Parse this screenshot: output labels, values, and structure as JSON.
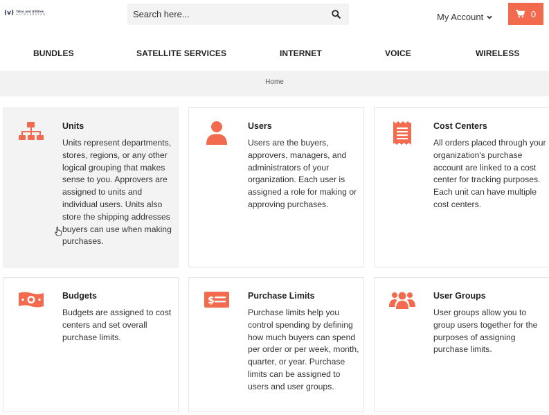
{
  "header": {
    "logo_name": "Telco and Utilities",
    "logo_subtitle": "ACCELERATOR",
    "search_placeholder": "Search here...",
    "account_label": "My Account",
    "cart_count": "0"
  },
  "nav": {
    "items": [
      {
        "label": "BUNDLES"
      },
      {
        "label": "SATELLITE SERVICES"
      },
      {
        "label": "INTERNET"
      },
      {
        "label": "VOICE"
      },
      {
        "label": "WIRELESS"
      }
    ]
  },
  "breadcrumb": {
    "home": "Home"
  },
  "cards": [
    {
      "icon": "org-chart-icon",
      "title": "Units",
      "description": "Units represent departments, stores, regions, or any other logical grouping that makes sense to you. Approvers are assigned to units and individual users. Units also store the shipping addresses buyers can use when making purchases."
    },
    {
      "icon": "user-icon",
      "title": "Users",
      "description": "Users are the buyers, approvers, managers, and administrators of your organization. Each user is assigned a role for making or approving purchases."
    },
    {
      "icon": "receipt-icon",
      "title": "Cost Centers",
      "description": "All orders placed through your organization's purchase account are linked to a cost center for tracking purposes. Each unit can have multiple cost centers."
    },
    {
      "icon": "money-bill-icon",
      "title": "Budgets",
      "description": "Budgets are assigned to cost centers and set overall purchase limits."
    },
    {
      "icon": "money-check-icon",
      "title": "Purchase Limits",
      "description": "Purchase limits help you control spending by defining how much buyers can spend per order or per week, month, quarter, or year. Purchase limits can be assigned to users and user groups."
    },
    {
      "icon": "users-icon",
      "title": "User Groups",
      "description": "User groups allow you to group users together for the purposes of assigning purchase limits."
    }
  ],
  "colors": {
    "accent": "#f26b4f",
    "breadcrumb_bg": "#f2f2f2",
    "active_card_bg": "#f3f3f3"
  }
}
